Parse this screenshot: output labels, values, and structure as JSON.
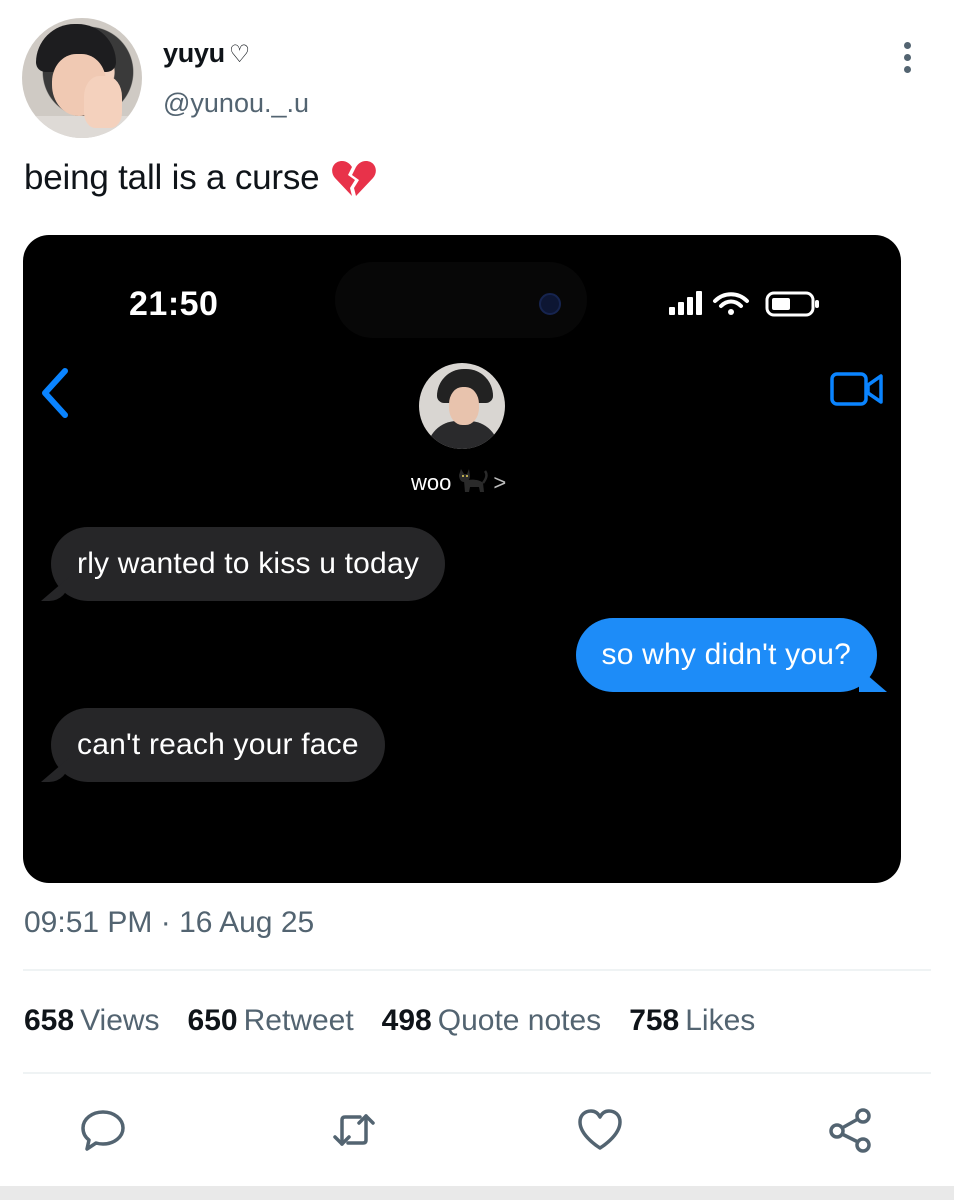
{
  "tweet": {
    "author": {
      "display_name": "yuyu",
      "name_symbol": "♡",
      "handle": "@yunou._.u"
    },
    "text": "being tall is a curse",
    "text_emoji": "broken-heart",
    "timestamp": "09:51 PM · 16 Aug 25",
    "stats": [
      {
        "value": "658",
        "label": "Views"
      },
      {
        "value": "650",
        "label": "Retweet"
      },
      {
        "value": "498",
        "label": "Quote notes"
      },
      {
        "value": "758",
        "label": "Likes"
      }
    ],
    "actions": [
      "reply-icon",
      "retweet-icon",
      "like-icon",
      "share-icon"
    ]
  },
  "media": {
    "status_bar": {
      "time": "21:50",
      "icons": [
        "signal-icon",
        "wifi-icon",
        "battery-icon"
      ]
    },
    "contact": {
      "name": "woo",
      "emoji": "black-cat",
      "chevron": ">"
    },
    "messages": [
      {
        "direction": "incoming",
        "text": "rly wanted to kiss u today"
      },
      {
        "direction": "outgoing",
        "text": "so why didn't you?"
      },
      {
        "direction": "incoming",
        "text": "can't reach your face"
      }
    ]
  },
  "colors": {
    "text_primary": "#0f1419",
    "text_secondary": "#536471",
    "imessage_blue": "#1d8cf8",
    "incoming_bubble": "#262628",
    "ios_accent": "#0a84ff"
  }
}
